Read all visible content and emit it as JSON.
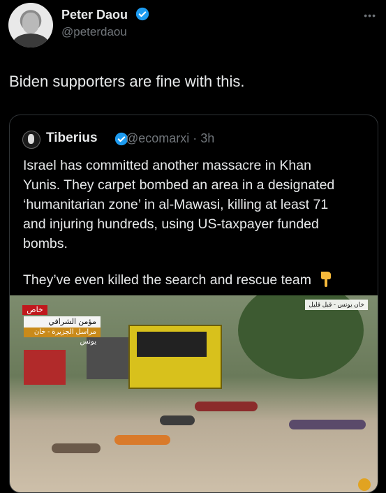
{
  "author": {
    "name": "Peter Daou",
    "handle": "@peterdaou"
  },
  "tweet": {
    "text": "Biden supporters are fine with this."
  },
  "quoted": {
    "name": "Tiberius",
    "handle": "@ecomarxi · 3h",
    "body": "Israel has committed another massacre in Khan\nYunis. They carpet bombed an area in a designated\n‘humanitarian zone’ in al-Mawasi, killing at least 71\nand injuring hundreds, using US-taxpayer funded\nbombs.",
    "body2": "They’ve even killed the search and rescue team"
  },
  "media": {
    "breaking_label": "خاص",
    "reporter_name": "مؤمن الشرافي",
    "reporter_title": "مراسل الجزيرة - خان يونس",
    "location_tag": "خان يونس - قبل قليل"
  },
  "colors": {
    "background": "#000000",
    "verified": "#1d9bf0",
    "muted": "#71767b"
  }
}
